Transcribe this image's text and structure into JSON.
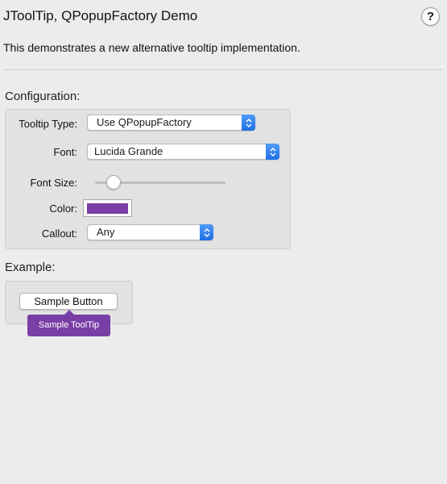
{
  "header": {
    "title": "JToolTip, QPopupFactory Demo",
    "help_label": "?",
    "description": "This demonstrates a new alternative tooltip implementation."
  },
  "configuration": {
    "title": "Configuration:",
    "tooltip_type": {
      "label": "Tooltip Type:",
      "value": "Use QPopupFactory"
    },
    "font": {
      "label": "Font:",
      "value": "Lucida Grande"
    },
    "font_size": {
      "label": "Font Size:",
      "slider_level": 0.1
    },
    "color": {
      "label": "Color:",
      "value": "#7a3fa6"
    },
    "callout": {
      "label": "Callout:",
      "value": "Any"
    }
  },
  "example": {
    "title": "Example:",
    "button_label": "Sample Button",
    "tooltip_text": "Sample ToolTip",
    "tooltip_color": "#7a3fa6"
  },
  "icons": {
    "help": "help-icon",
    "select_arrows": "up-down-arrows-icon"
  }
}
